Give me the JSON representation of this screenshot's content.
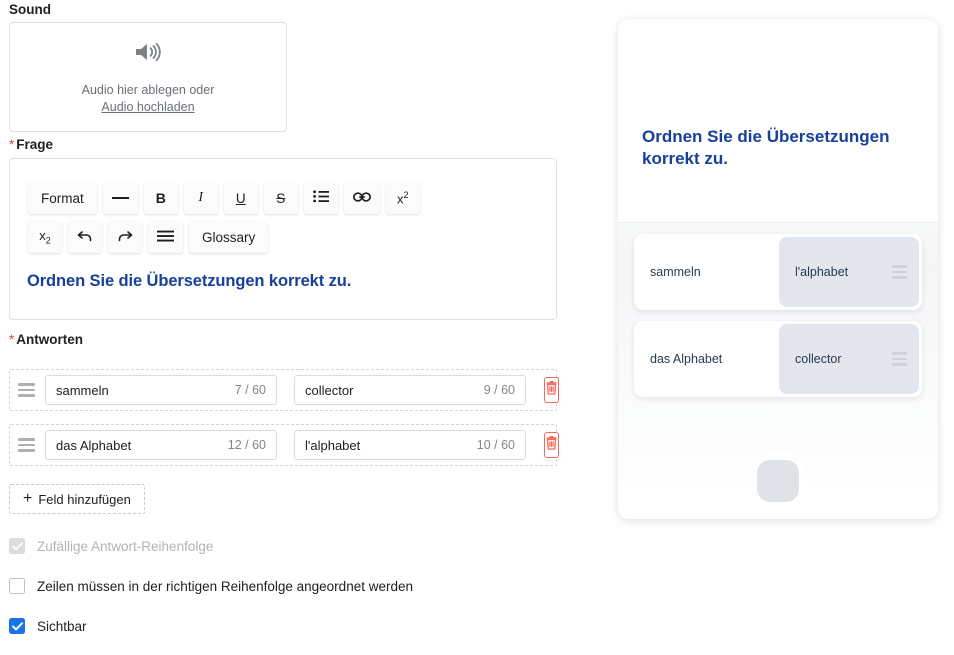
{
  "editor": {
    "sound": {
      "label": "Sound",
      "icon": "speaker-icon",
      "drop_text": "Audio hier ablegen oder",
      "upload_link": "Audio hochladen"
    },
    "question": {
      "label": "Frage",
      "required_marker": "*",
      "toolbar_row1": [
        {
          "name": "format-dropdown",
          "label": "Format",
          "icon": "text"
        },
        {
          "name": "horizontal-rule-button",
          "label": "—",
          "icon": "horizontal-rule-icon"
        },
        {
          "name": "bold-button",
          "label": "B",
          "icon": "bold-icon"
        },
        {
          "name": "italic-button",
          "label": "I",
          "icon": "italic-icon"
        },
        {
          "name": "underline-button",
          "label": "U",
          "icon": "underline-icon"
        },
        {
          "name": "strikethrough-button",
          "label": "S",
          "icon": "strikethrough-icon"
        },
        {
          "name": "bullet-list-button",
          "label": "",
          "icon": "bullet-list-icon"
        },
        {
          "name": "link-button",
          "label": "",
          "icon": "link-icon"
        },
        {
          "name": "superscript-button",
          "label": "x2",
          "icon": "superscript-icon"
        }
      ],
      "toolbar_row2": [
        {
          "name": "subscript-button",
          "label": "x2",
          "icon": "subscript-icon"
        },
        {
          "name": "undo-button",
          "label": "",
          "icon": "undo-icon"
        },
        {
          "name": "redo-button",
          "label": "",
          "icon": "redo-icon"
        },
        {
          "name": "align-button",
          "label": "",
          "icon": "align-icon"
        },
        {
          "name": "glossary-button",
          "label": "Glossary",
          "icon": "text"
        }
      ],
      "content": "Ordnen Sie die Übersetzungen korrekt zu.",
      "content_color": "#16409c"
    },
    "answers": {
      "label": "Antworten",
      "required_marker": "*",
      "max_length": 60,
      "rows": [
        {
          "left_value": "sammeln",
          "left_count": "7 / 60",
          "right_value": "collector",
          "right_count": "9 / 60",
          "delete_icon": "trash-icon",
          "drag_icon": "drag-handle-icon"
        },
        {
          "left_value": "das Alphabet",
          "left_count": "12 / 60",
          "right_value": "l'alphabet",
          "right_count": "10 / 60",
          "delete_icon": "trash-icon",
          "drag_icon": "drag-handle-icon"
        }
      ],
      "add_button_label": "Feld hinzufügen",
      "add_button_plus": "+"
    },
    "options": [
      {
        "name": "random-answer-order",
        "label": "Zufällige Antwort-Reihenfolge",
        "checked": true,
        "disabled": true
      },
      {
        "name": "rows-must-be-ordered",
        "label": "Zeilen müssen in der richtigen Reihenfolge angeordnet werden",
        "checked": false,
        "disabled": false
      },
      {
        "name": "visible",
        "label": "Sichtbar",
        "checked": true,
        "disabled": false
      }
    ]
  },
  "preview": {
    "question_text": "Ordnen Sie die Übersetzungen korrekt zu.",
    "question_color": "#16409c",
    "cards": [
      {
        "term": "sammeln",
        "match": "l'alphabet",
        "handle_icon": "drag-handle-icon"
      },
      {
        "term": "das Alphabet",
        "match": "collector",
        "handle_icon": "drag-handle-icon"
      }
    ],
    "home_button_icon": "home-button-icon"
  },
  "colors": {
    "accent_blue": "#16409c",
    "checkbox_blue": "#1a73e8",
    "danger_red": "#f4695c",
    "required_star": "#e8452c",
    "tile_gray": "#e3e7ed"
  }
}
